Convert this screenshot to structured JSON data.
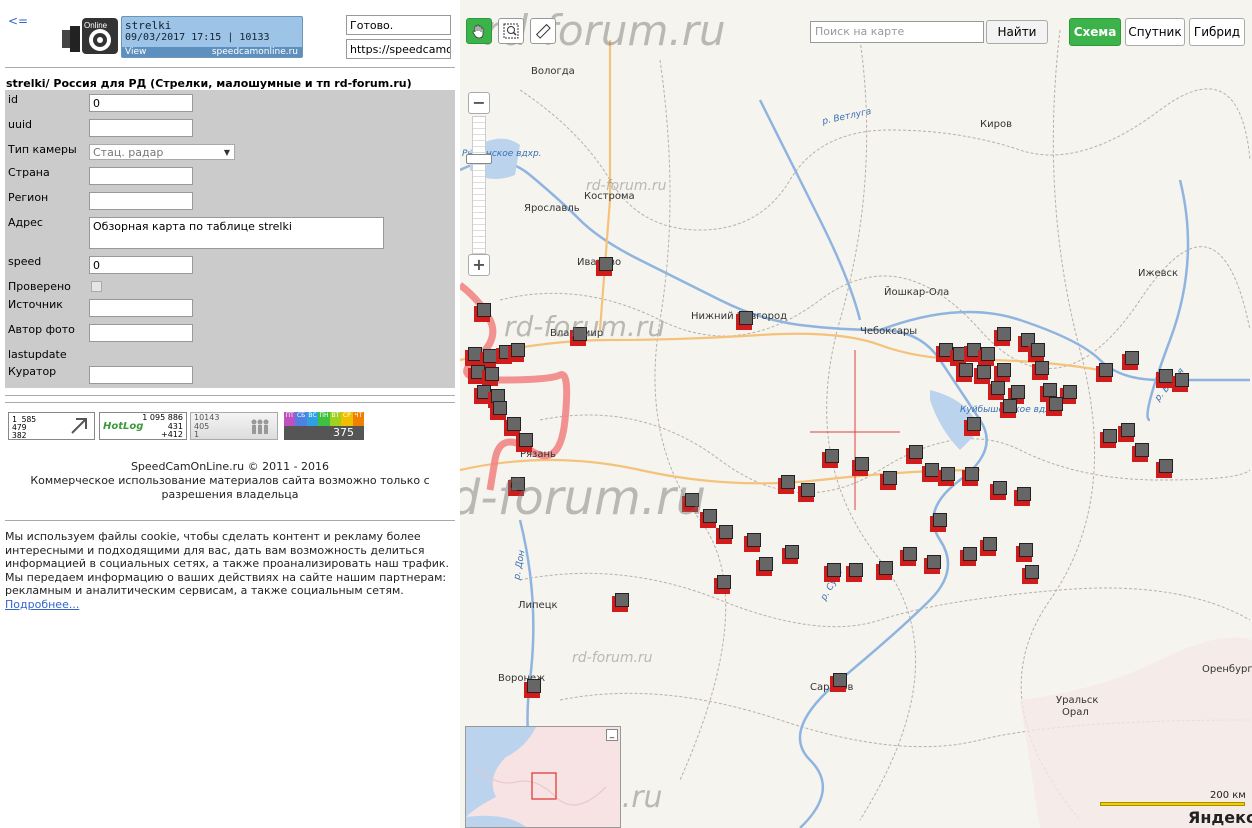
{
  "left": {
    "back_label": "<=",
    "logo_text": "Online",
    "camera": {
      "name": "strelki",
      "date_line": "09/03/2017 17:15 | 10133",
      "view_label": "View",
      "site": "speedcamonline.ru"
    },
    "status": "Готово.",
    "url": "https://speedcamonline.ru",
    "form_title": "strelki/ Россия для РД (Стрелки, малошумные и тп rd-forum.ru)",
    "fields": {
      "id_label": "id",
      "id_value": "0",
      "uuid_label": "uuid",
      "uuid_value": "",
      "camtype_label": "Тип камеры",
      "camtype_value": "Стац. радар",
      "country_label": "Страна",
      "country_value": "",
      "region_label": "Регион",
      "region_value": "",
      "address_label": "Адрес",
      "address_value": "Обзорная карта по таблице strelki",
      "speed_label": "speed",
      "speed_value": "0",
      "checked_label": "Проверено",
      "source_label": "Источник",
      "source_value": "",
      "author_label": "Автор фото",
      "author_value": "",
      "lastupdate_label": "lastupdate",
      "curator_label": "Куратор",
      "curator_value": ""
    },
    "counters": {
      "c1": [
        "1 585",
        "479",
        "382"
      ],
      "c2_logo": "HotLog",
      "c2": [
        "1 095 886",
        "431",
        "+412"
      ],
      "c3": [
        "10143",
        "405",
        "1"
      ],
      "c4_days": [
        "ПТ",
        "СБ",
        "ВС",
        "ПН",
        "ВТ",
        "СР",
        "ЧТ"
      ],
      "c4_value": "375"
    },
    "copyright": "SpeedCamOnLine.ru © 2011 - 2016",
    "copyright_note": "Коммерческое использование материалов сайта возможно только с разрешения владельца",
    "cookie_text": "Мы используем файлы cookie, чтобы сделать контент и рекламу более интересными и подходящими для вас, дать вам возможность делиться информацией в социальных сетях, а также проанализировать наш трафик. Мы передаем информацию о ваших действиях на сайте нашим партнерам: рекламным и аналитическим сервисам, а также социальным сетям.",
    "cookie_link": "Подробнее..."
  },
  "map": {
    "search_placeholder": "Поиск на карте",
    "search_button": "Найти",
    "types": [
      "Схема",
      "Спутник",
      "Гибрид"
    ],
    "zoom_in": "+",
    "zoom_out": "−",
    "scale": "200 км",
    "brand": "Яндекс",
    "watermark": "rd-forum.ru",
    "cities": [
      "Вологда",
      "Киров",
      "Кострома",
      "Ярославль",
      "Иваново",
      "Ижевск",
      "Йошкар-Ола",
      "Нижний Новгород",
      "Владимир",
      "Чебоксары",
      "Рязань",
      "Липецк",
      "Воронеж",
      "Саратов",
      "Уральск",
      "Орал",
      "Оренбург"
    ],
    "rivers": [
      "р. Ветлуга",
      "Рыбинское вдхр.",
      "р. Белая",
      "Куйбышевское вдхр.",
      "р. Дон",
      "р. Сура"
    ],
    "colors": {
      "active": "#3bb34a",
      "marker": "#d21b1b",
      "route": "#f08080"
    }
  }
}
